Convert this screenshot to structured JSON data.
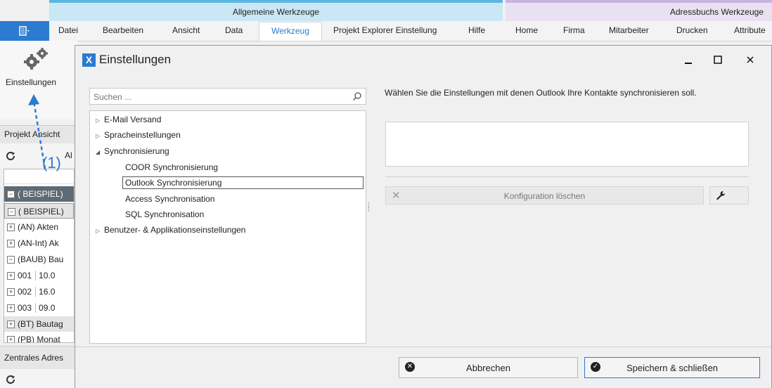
{
  "ribbon": {
    "context_left": "Allgemeine Werkzeuge",
    "context_right": "Adressbuchs Werkzeuge",
    "app_menu_icon": "menu-icon",
    "tabs": [
      {
        "label": "Datei"
      },
      {
        "label": "Bearbeiten"
      },
      {
        "label": "Ansicht"
      },
      {
        "label": "Data"
      },
      {
        "label": "Werkzeug"
      },
      {
        "label": "Projekt Explorer Einstellung"
      },
      {
        "label": "Hilfe"
      },
      {
        "label": "Home"
      },
      {
        "label": "Firma"
      },
      {
        "label": "Mitarbeiter"
      },
      {
        "label": "Drucken"
      },
      {
        "label": "Attribute"
      }
    ],
    "active_tab": "Werkzeug",
    "settings_button": "Einstellungen"
  },
  "annotation": {
    "label": "(1)"
  },
  "project_pane": {
    "header": "Projekt Ansicht",
    "toolbar_text": "Al",
    "rows": [
      {
        "text": "( BEISPIEL)",
        "sign": "−"
      },
      {
        "text": "( BEISPIEL)",
        "sign": "−"
      },
      {
        "text": "(AN) Akten",
        "sign": "+"
      },
      {
        "text": "(AN-Int) Ak",
        "sign": "+"
      },
      {
        "text": "(BAUB) Bau",
        "sign": "−"
      },
      {
        "text": "001",
        "date": "10.0",
        "sign": "+"
      },
      {
        "text": "002",
        "date": "16.0",
        "sign": "+"
      },
      {
        "text": "003",
        "date": "09.0",
        "sign": "+"
      },
      {
        "text": "(BT) Bautag",
        "sign": "+"
      },
      {
        "text": "(PB) Monat",
        "sign": "+"
      }
    ]
  },
  "address_pane": {
    "header": "Zentrales Adres"
  },
  "dialog": {
    "title": "Einstellungen",
    "logo": "X",
    "search_placeholder": "Suchen ...",
    "tree": {
      "email": "E-Mail Versand",
      "language": "Spracheinstellungen",
      "sync": "Synchronisierung",
      "coor": "COOR Synchronisierung",
      "outlook": "Outlook Synchronisierung",
      "access": "Access Synchronisation",
      "sql": "SQL Synchronisation",
      "user_app": "Benutzer- & Applikationseinstellungen"
    },
    "description": "Wählen Sie die Einstellungen mit denen Outlook Ihre Kontakte synchronisieren soll.",
    "delete_config": "Konfiguration löschen",
    "cancel": "Abbrechen",
    "save_close": "Speichern & schließen"
  }
}
